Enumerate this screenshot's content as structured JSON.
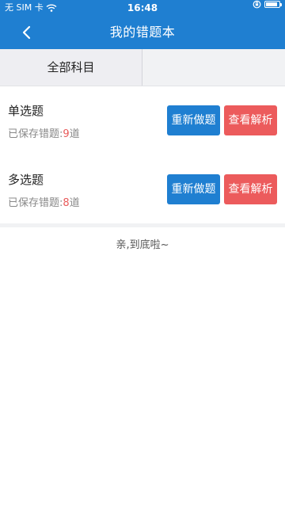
{
  "status_bar": {
    "carrier": "无 SIM 卡",
    "time": "16:48"
  },
  "header": {
    "title": "我的错题本"
  },
  "tabs": [
    {
      "label": "全部科目"
    },
    {
      "label": ""
    }
  ],
  "cards": [
    {
      "title": "单选题",
      "count_prefix": "已保存错题:",
      "count": "9",
      "count_suffix": "道",
      "redo_label": "重新做题",
      "analysis_label": "查看解析"
    },
    {
      "title": "多选题",
      "count_prefix": "已保存错题:",
      "count": "8",
      "count_suffix": "道",
      "redo_label": "重新做题",
      "analysis_label": "查看解析"
    }
  ],
  "footer": {
    "end_message": "亲,到底啦~"
  },
  "colors": {
    "primary": "#1f7fd1",
    "danger": "#ec5b5c",
    "count_highlight": "#e85a5a"
  },
  "icons": {
    "back": "chevron-left-icon",
    "wifi": "wifi-icon",
    "rotation_lock": "lock-rotation-icon",
    "battery": "battery-icon"
  }
}
